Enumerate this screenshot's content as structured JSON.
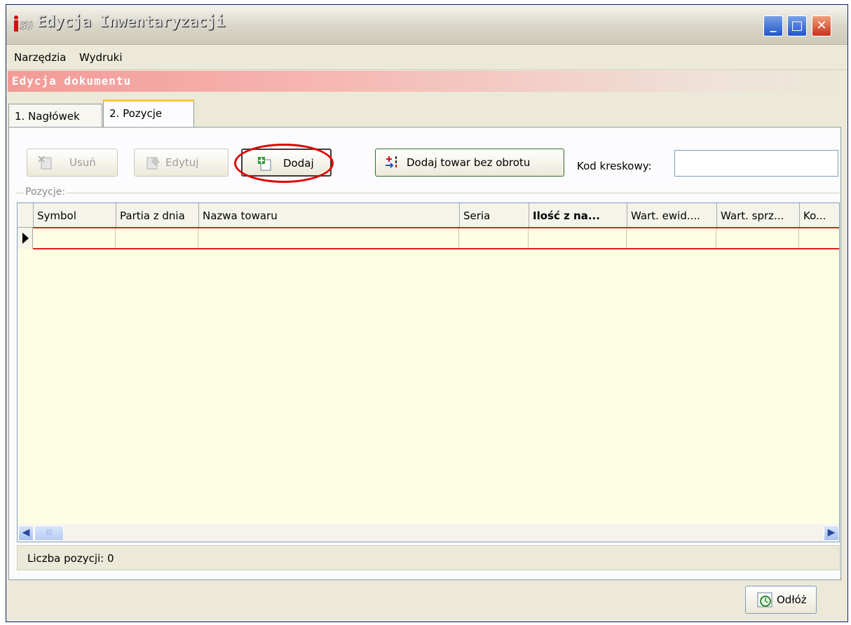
{
  "window": {
    "title": "Edycja Inwentaryzacji",
    "icon": "isu-app-icon",
    "controls": [
      "minimize-icon",
      "maximize-icon",
      "close-icon"
    ]
  },
  "menubar": {
    "items": [
      {
        "label": "Narzędzia"
      },
      {
        "label": "Wydruki"
      }
    ]
  },
  "section": {
    "title": "Edycja dokumentu"
  },
  "tabs": [
    {
      "label": "1. Nagłówek",
      "active": false
    },
    {
      "label": "2. Pozycje",
      "active": true
    }
  ],
  "toolbar": {
    "remove_label": "Usuń",
    "edit_label": "Edytuj",
    "add_label": "Dodaj",
    "add_no_turnover_label": "Dodaj towar bez obrotu",
    "barcode_label": "Kod kreskowy:",
    "barcode_value": ""
  },
  "positions": {
    "group_label": "Pozycje:",
    "columns": [
      "Symbol",
      "Partia z dnia",
      "Nazwa towaru",
      "Seria",
      "Ilość z na...",
      "Wart. ewid....",
      "Wart. sprz...",
      "Ko..."
    ],
    "rows": [
      [
        "",
        "",
        "",
        "",
        "",
        "",
        "",
        ""
      ]
    ]
  },
  "status": {
    "count_text": "Liczba pozycji: 0"
  },
  "footer": {
    "close_label": "Odłóż"
  },
  "colors": {
    "window_bg": "#ECE9D8",
    "banner": "#F39A97",
    "grid_bg": "#FEFEE4",
    "selected_row_border": "#E02020",
    "highlight_ellipse": "#E00000"
  }
}
